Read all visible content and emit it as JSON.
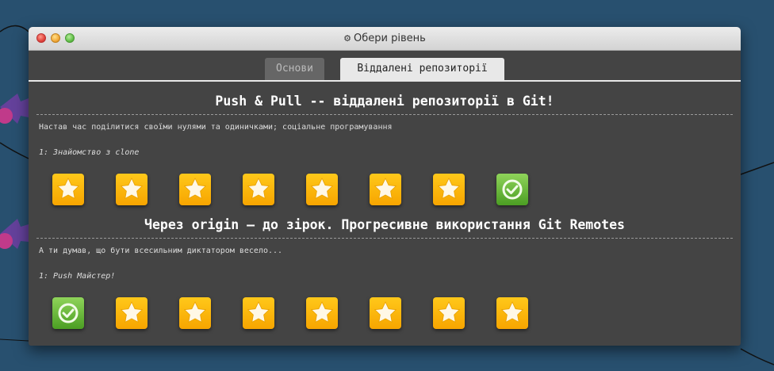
{
  "window": {
    "title": "Обери рівень",
    "title_icon": "gear-icon"
  },
  "tabs": [
    {
      "label": "Основи",
      "active": false
    },
    {
      "label": "Віддалені репозиторії",
      "active": true
    }
  ],
  "sections": [
    {
      "title": "Push & Pull -- віддалені репозиторії в Git!",
      "description": "Настав час поділитися своїми нулями та одиничками; соціальне програмування",
      "selected_level": "1: Знайомство з clone",
      "levels": [
        "star",
        "star",
        "star",
        "star",
        "star",
        "star",
        "star",
        "check"
      ]
    },
    {
      "title": "Через origin – до зірок. Прогресивне використання Git Remotes",
      "description": "А ти думав, що бути всесильним диктатором весело...",
      "selected_level": "1: Push Майстер!",
      "levels": [
        "check",
        "star",
        "star",
        "star",
        "star",
        "star",
        "star",
        "star"
      ]
    }
  ],
  "colors": {
    "background": "#28506f",
    "window": "#444444",
    "level_pending": "#f7a500",
    "level_done": "#4b9e23"
  }
}
